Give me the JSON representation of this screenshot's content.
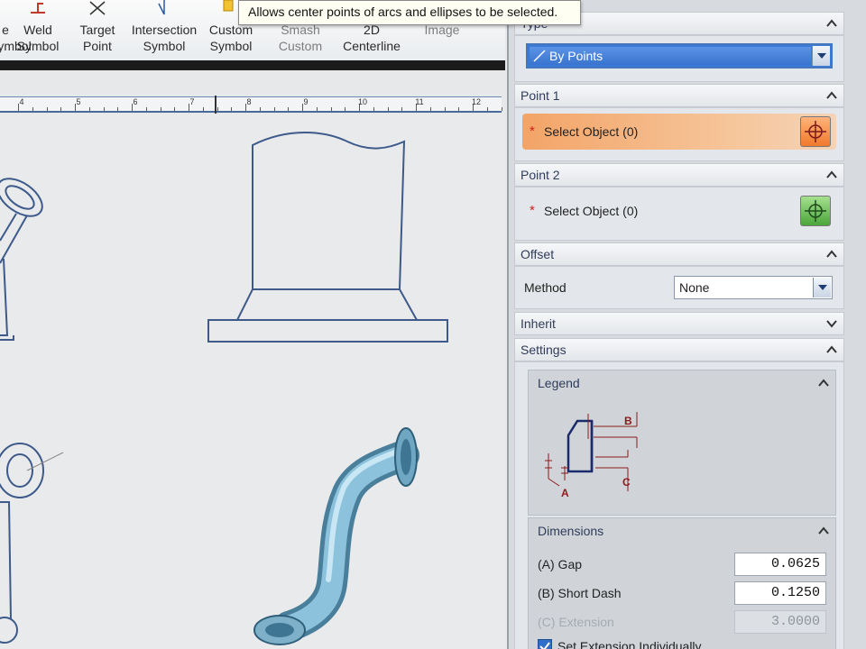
{
  "ribbon": {
    "buttons": [
      {
        "label": "e\nSymbol",
        "line1": "e",
        "line2": ""
      },
      {
        "line1": "Weld",
        "line2": "Symbol"
      },
      {
        "line1": "Target",
        "line2": "Point"
      },
      {
        "line1": "Intersection",
        "line2": "Symbol"
      },
      {
        "line1": "Custom",
        "line2": "Symbol"
      },
      {
        "line1": "Smash",
        "line2": "Custom"
      },
      {
        "line1": "2D",
        "line2": "Centerline"
      },
      {
        "line1": "Image",
        "line2": ""
      }
    ],
    "tooltip": "Allows center points of arcs and ellipses to be selected."
  },
  "ruler": {
    "labels": [
      "4",
      "5",
      "6",
      "7",
      "8",
      "9",
      "10",
      "11",
      "12"
    ]
  },
  "panel": {
    "type_header": "Type",
    "type_value": "By Points",
    "point1": {
      "header": "Point 1",
      "select": "Select Object (0)"
    },
    "point2": {
      "header": "Point 2",
      "select": "Select Object (0)"
    },
    "offset": {
      "header": "Offset",
      "method_label": "Method",
      "method_value": "None"
    },
    "inherit_header": "Inherit",
    "settings_header": "Settings",
    "legend": {
      "header": "Legend",
      "labels": {
        "a": "A",
        "b": "B",
        "c": "C"
      }
    },
    "dimensions": {
      "header": "Dimensions",
      "gap_label": "(A) Gap",
      "gap_value": "0.0625",
      "short_dash_label": "(B) Short Dash",
      "short_dash_value": "0.1250",
      "extension_label": "(C) Extension",
      "extension_value": "3.0000",
      "set_extension_label": "Set Extension Individually"
    }
  },
  "colors": {
    "accent": "#3a7ad8",
    "select_active": "#f3a467",
    "drawing_line": "#3d5a8a",
    "pipe": "#7fb0c9"
  }
}
